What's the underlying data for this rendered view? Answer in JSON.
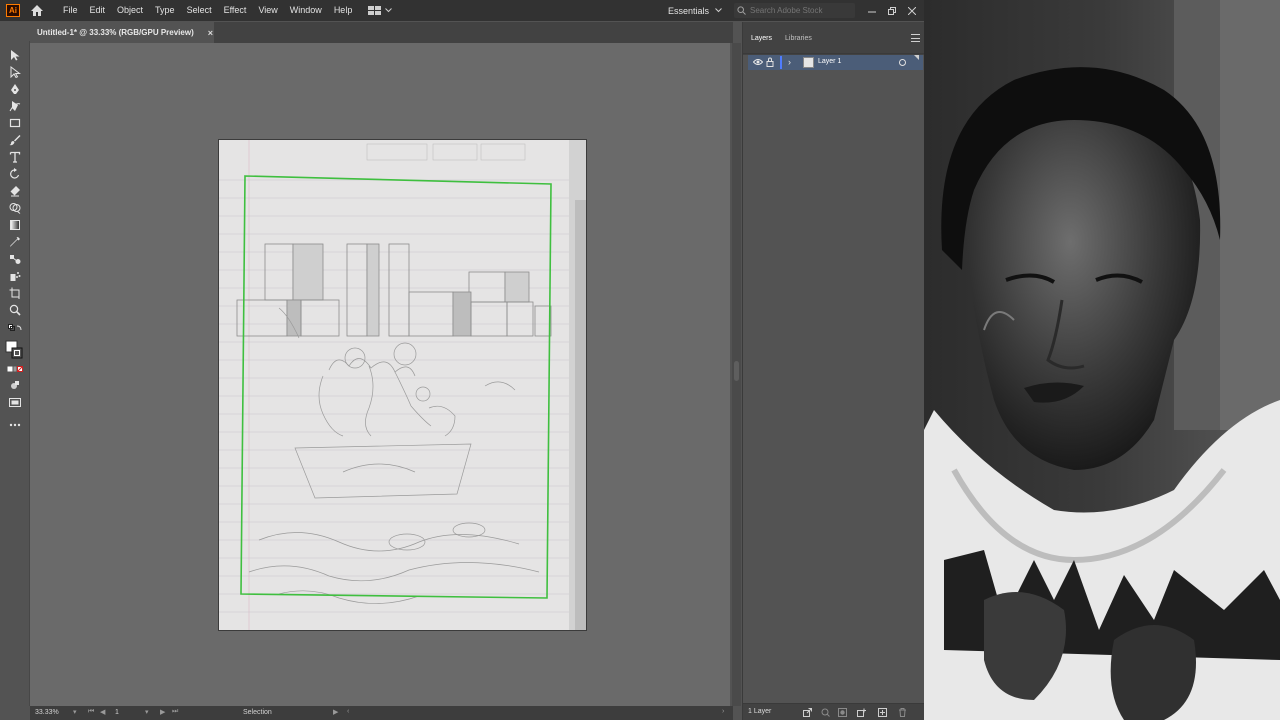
{
  "app": {
    "logo_text": "Ai"
  },
  "menubar": {
    "items": [
      "File",
      "Edit",
      "Object",
      "Type",
      "Select",
      "Effect",
      "View",
      "Window",
      "Help"
    ],
    "workspace_label": "Essentials",
    "search_placeholder": "Search Adobe Stock"
  },
  "document": {
    "tab_title": "Untitled-1* @ 33.33% (RGB/GPU Preview)",
    "tab_close": "×"
  },
  "status": {
    "zoom": "33.33%",
    "artboard_number": "1",
    "current_tool": "Selection"
  },
  "panels": {
    "tabs": [
      "Layers",
      "Libraries"
    ],
    "active_tab": "Layers",
    "layers": [
      {
        "name": "Layer 1",
        "visible": true,
        "color": "#4f7cff"
      }
    ],
    "footer_count": "1 Layer"
  },
  "colors": {
    "app_bg": "#535353",
    "canvas_bg": "#6a6a6a",
    "menubar_bg": "#323232",
    "layer_selection": "#4b5d78",
    "layer_color": "#4f7cff",
    "artboard_guide": "#3fbf3f"
  },
  "icons": [
    "selection-tool-icon",
    "direct-selection-tool-icon",
    "pen-tool-icon",
    "curvature-tool-icon",
    "rectangle-tool-icon",
    "paintbrush-tool-icon",
    "type-tool-icon",
    "rotate-tool-icon",
    "eraser-tool-icon",
    "shape-builder-tool-icon",
    "gradient-tool-icon",
    "eyedropper-tool-icon",
    "blend-tool-icon",
    "symbol-sprayer-tool-icon",
    "artboard-tool-icon",
    "zoom-tool-icon",
    "fill-stroke-swatch-icon",
    "drawing-mode-icon",
    "screen-mode-icon",
    "more-tools-icon"
  ]
}
